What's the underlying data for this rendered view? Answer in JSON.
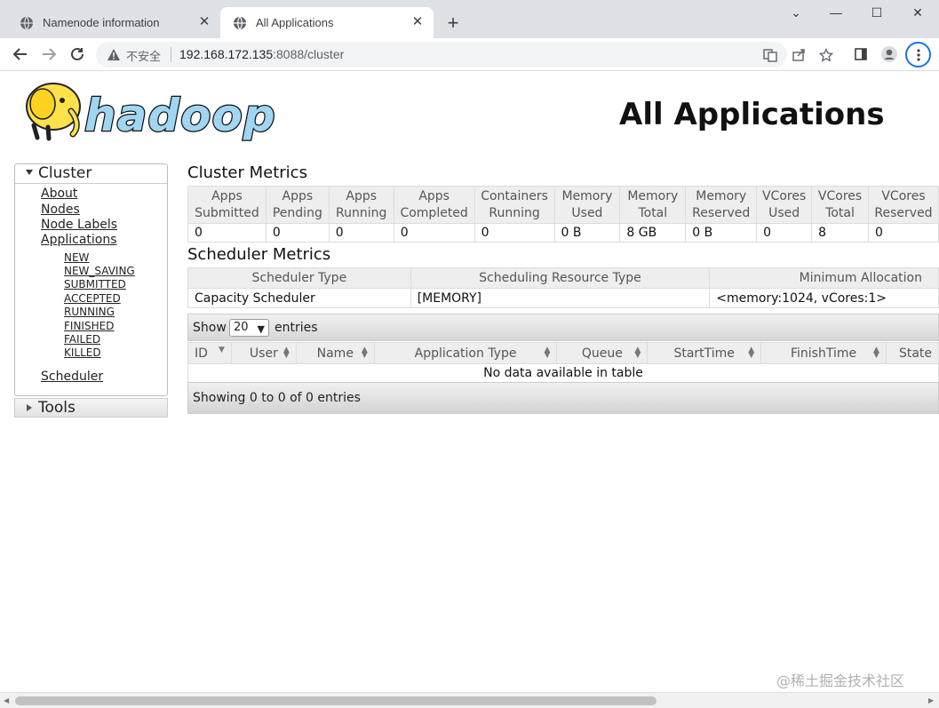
{
  "browser": {
    "tabs": [
      {
        "title": "Namenode information",
        "active": false
      },
      {
        "title": "All Applications",
        "active": true
      }
    ],
    "address": {
      "security_label": "不安全",
      "host": "192.168.172.135",
      "path": ":8088/cluster"
    }
  },
  "page": {
    "title": "All Applications",
    "logo_text": "hadoop"
  },
  "sidebar": {
    "cluster_label": "Cluster",
    "links": [
      "About",
      "Nodes",
      "Node Labels",
      "Applications"
    ],
    "app_states": [
      "NEW",
      "NEW_SAVING",
      "SUBMITTED",
      "ACCEPTED",
      "RUNNING",
      "FINISHED",
      "FAILED",
      "KILLED"
    ],
    "scheduler_label": "Scheduler",
    "tools_label": "Tools"
  },
  "cluster_metrics": {
    "title": "Cluster Metrics",
    "headers": [
      [
        "Apps",
        "Submitted"
      ],
      [
        "Apps",
        "Pending"
      ],
      [
        "Apps",
        "Running"
      ],
      [
        "Apps",
        "Completed"
      ],
      [
        "Containers",
        "Running"
      ],
      [
        "Memory",
        "Used"
      ],
      [
        "Memory",
        "Total"
      ],
      [
        "Memory",
        "Reserved"
      ],
      [
        "VCores",
        "Used"
      ],
      [
        "VCores",
        "Total"
      ],
      [
        "VCores",
        "Reserved"
      ]
    ],
    "values": [
      "0",
      "0",
      "0",
      "0",
      "0",
      "0 B",
      "8 GB",
      "0 B",
      "0",
      "8",
      "0"
    ]
  },
  "scheduler_metrics": {
    "title": "Scheduler Metrics",
    "headers": [
      "Scheduler Type",
      "Scheduling Resource Type",
      "Minimum Allocation"
    ],
    "values": [
      "Capacity Scheduler",
      "[MEMORY]",
      "<memory:1024, vCores:1>"
    ]
  },
  "apps_table": {
    "show_label": "Show",
    "page_size": "20",
    "entries_label": "entries",
    "headers": [
      "ID",
      "User",
      "Name",
      "Application Type",
      "Queue",
      "StartTime",
      "FinishTime",
      "State"
    ],
    "empty_message": "No data available in table",
    "info": "Showing 0 to 0 of 0 entries"
  },
  "watermark": "@稀土掘金技术社区",
  "colors": {
    "logo_blue": "#9fd6f2",
    "logo_yellow": "#ffe24a",
    "link": "#222222"
  }
}
